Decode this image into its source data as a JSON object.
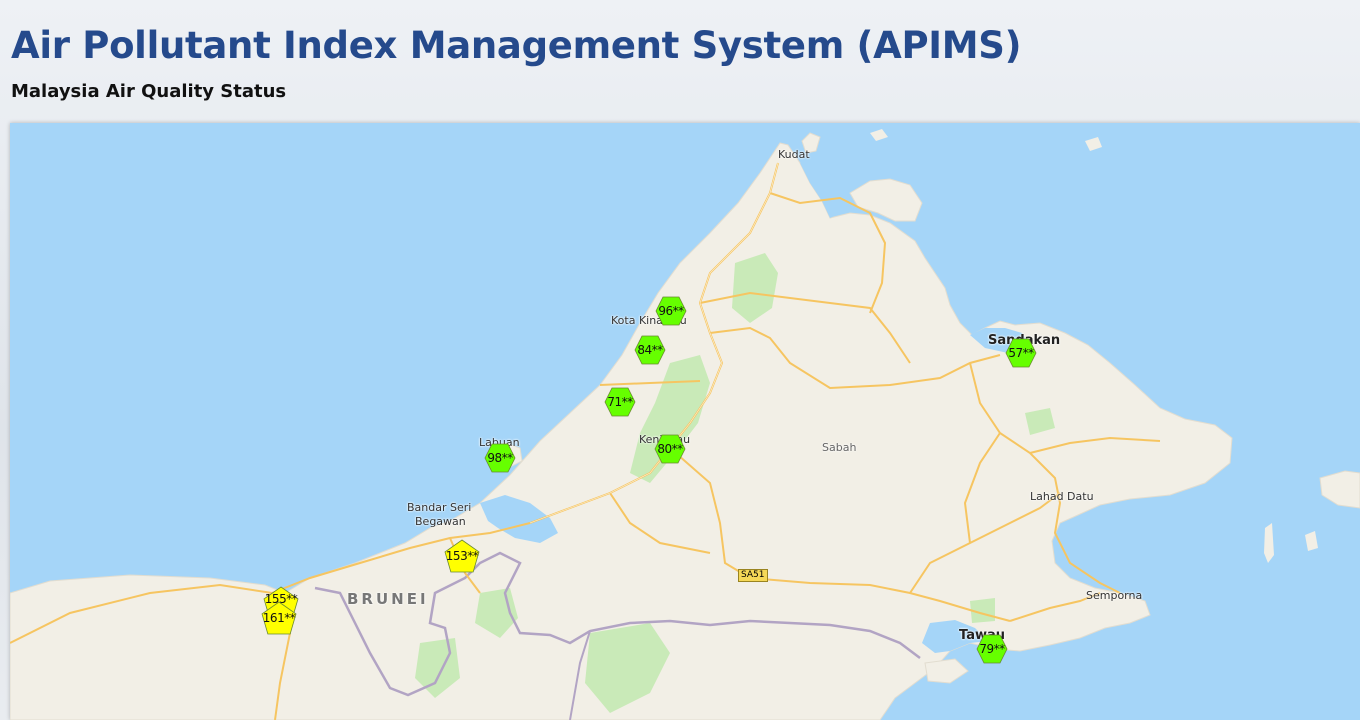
{
  "header": {
    "title": "Air Pollutant Index Management System (APIMS)",
    "subtitle": "Malaysia Air Quality Status"
  },
  "colors": {
    "good": "#66ff00",
    "moderate": "#ffff00",
    "sea": "#a5d5f8",
    "land": "#f2efe6",
    "road": "#f6c561",
    "park": "#c9eab8",
    "border": "#b2a4c4"
  },
  "places": {
    "kudat": "Kudat",
    "kota_kinabalu": "Kota Kinabalu",
    "sandakan": "Sandakan",
    "labuan": "Labuan",
    "keningau": "Keningau",
    "sabah": "Sabah",
    "bandar_seri_begawan_1": "Bandar Seri",
    "bandar_seri_begawan_2": "Begawan",
    "lahad_datu": "Lahad Datu",
    "brunei": "BRUNEI",
    "semporna": "Semporna",
    "tawau": "Tawau",
    "road_sa51": "SA51"
  },
  "stations": [
    {
      "id": "kota-kinabalu",
      "label": "96**",
      "value": 96,
      "status": "good"
    },
    {
      "id": "kota-kinabalu-south",
      "label": "84**",
      "value": 84,
      "status": "good"
    },
    {
      "id": "kimanis",
      "label": "71**",
      "value": 71,
      "status": "good"
    },
    {
      "id": "keningau",
      "label": "80**",
      "value": 80,
      "status": "good"
    },
    {
      "id": "labuan",
      "label": "98**",
      "value": 98,
      "status": "good"
    },
    {
      "id": "sandakan",
      "label": "57**",
      "value": 57,
      "status": "good"
    },
    {
      "id": "limbang",
      "label": "153**",
      "value": 153,
      "status": "moderate"
    },
    {
      "id": "miri",
      "label": "155**",
      "value": 155,
      "status": "moderate"
    },
    {
      "id": "miri-2",
      "label": "161**",
      "value": 161,
      "status": "moderate"
    },
    {
      "id": "tawau",
      "label": "79**",
      "value": 79,
      "status": "good"
    }
  ]
}
